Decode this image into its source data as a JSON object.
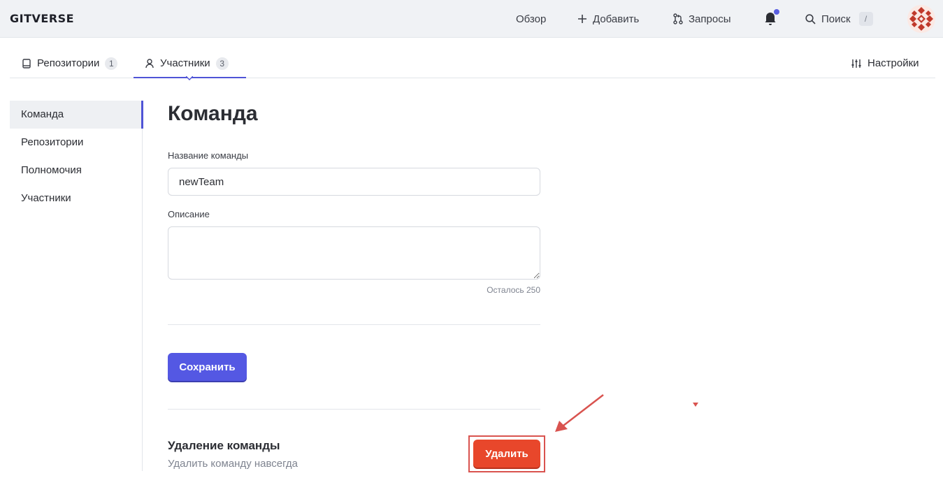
{
  "header": {
    "logo": "GITVERSE",
    "nav": {
      "overview": "Обзор",
      "add": "Добавить",
      "requests": "Запросы",
      "search": "Поиск",
      "search_shortcut": "/"
    },
    "notification_dot_color": "#5a5fe0"
  },
  "tabs": {
    "repositories": {
      "label": "Репозитории",
      "count": "1"
    },
    "members": {
      "label": "Участники",
      "count": "3"
    },
    "settings": {
      "label": "Настройки"
    }
  },
  "sidebar": {
    "items": [
      {
        "label": "Команда",
        "active": true
      },
      {
        "label": "Репозитории",
        "active": false
      },
      {
        "label": "Полномочия",
        "active": false
      },
      {
        "label": "Участники",
        "active": false
      }
    ]
  },
  "main": {
    "title": "Команда",
    "name_label": "Название команды",
    "name_value": "newTeam",
    "description_label": "Описание",
    "description_value": "",
    "remaining": "Осталось 250",
    "save_label": "Сохранить",
    "delete_section_title": "Удаление команды",
    "delete_section_desc": "Удалить команду навсегда",
    "delete_label": "Удалить"
  },
  "colors": {
    "accent": "#5458e3",
    "danger": "#e8472b",
    "annotation": "#d9534f"
  }
}
